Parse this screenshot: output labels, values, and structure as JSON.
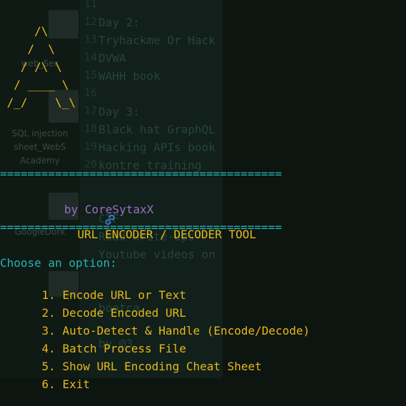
{
  "background": {
    "editor_lines": [
      {
        "no": "11",
        "text": ""
      },
      {
        "no": "12",
        "text": "Day 2:"
      },
      {
        "no": "13",
        "text": "Tryhackme Or Hack"
      },
      {
        "no": "14",
        "text": "DVWA"
      },
      {
        "no": "15",
        "text": "WAHH book"
      },
      {
        "no": "16",
        "text": ""
      },
      {
        "no": "17",
        "text": "Day 3:"
      },
      {
        "no": "18",
        "text": "Black hat GraphQL"
      },
      {
        "no": "19",
        "text": "Hacking APIs book"
      },
      {
        "no": "20",
        "text": "kontre training"
      },
      {
        "no": "",
        "text": ""
      },
      {
        "no": "",
        "text": ""
      },
      {
        "no": "",
        "text": "CTF"
      },
      {
        "no": "",
        "text": "Read write-ups"
      },
      {
        "no": "",
        "text": "Youtube videos on"
      },
      {
        "no": "",
        "text": ""
      },
      {
        "no": "",
        "text": ""
      },
      {
        "no": "",
        "text": "bootca"
      },
      {
        "no": "",
        "text": ""
      },
      {
        "no": "",
        "text": "by @3"
      }
    ],
    "desktop_labels": {
      "file1_a": "web_Sec",
      "file2_a": "SQL injection",
      "file2_b": "sheet_WebS",
      "file2_c": "Academy",
      "file3_a": "GoogleDork"
    }
  },
  "terminal": {
    "ascii_art": [
      "     /\\",
      "    /  \\",
      "   / /\\ \\",
      "  / ____ \\",
      " /_/    \\_\\"
    ],
    "separator": "=========================================",
    "title_icon": "link-icon",
    "title": "URL ENCODER / DECODER TOOL",
    "author": "by CoreSytaxX",
    "prompt": "Choose an option:",
    "options": [
      {
        "num": "1.",
        "label": "Encode URL or Text"
      },
      {
        "num": "2.",
        "label": "Decode Encoded URL"
      },
      {
        "num": "3.",
        "label": "Auto-Detect & Handle (Encode/Decode)"
      },
      {
        "num": "4.",
        "label": "Batch Process File"
      },
      {
        "num": "5.",
        "label": "Show URL Encoding Cheat Sheet"
      },
      {
        "num": "6.",
        "label": "Exit"
      }
    ]
  },
  "colors": {
    "ascii": "#e8b81a",
    "separator": "#27b3b3",
    "title": "#e8b81a",
    "author": "#9a6fc4",
    "prompt": "#27b3b3",
    "options": "#e8b81a"
  }
}
